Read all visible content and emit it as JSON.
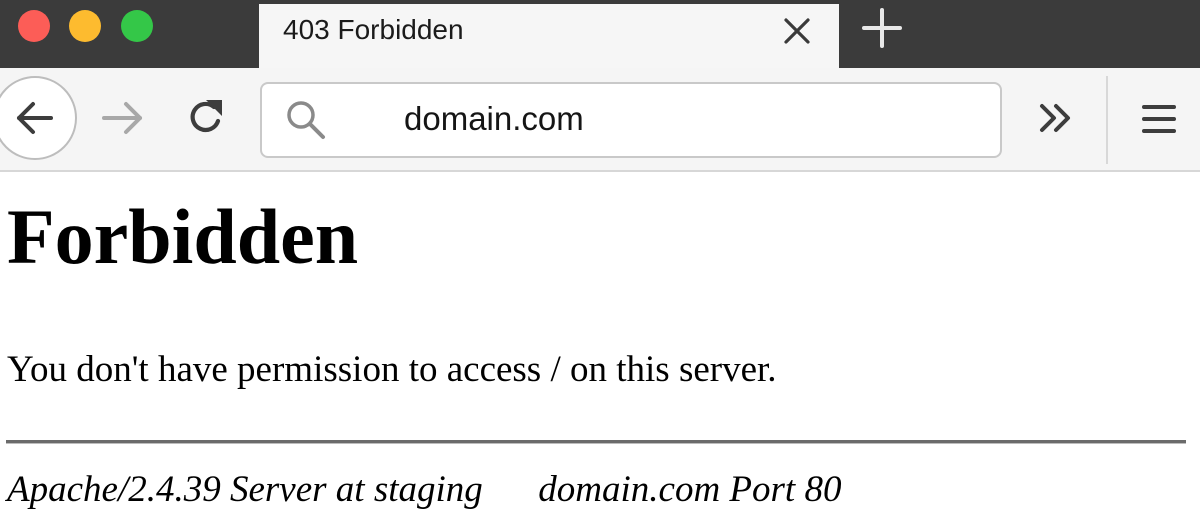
{
  "window": {
    "traffic_colors": {
      "close": "#fc5d57",
      "minimize": "#fdbb2f",
      "zoom": "#34c748"
    }
  },
  "tabs": [
    {
      "title": "403 Forbidden",
      "active": true
    }
  ],
  "tabbar": {
    "close_tab_icon": "close-icon",
    "new_tab_icon": "plus-icon"
  },
  "toolbar": {
    "back_icon": "arrow-left-icon",
    "forward_icon": "arrow-right-icon",
    "reload_icon": "reload-icon",
    "overflow_icon": "double-chevron-right-icon",
    "menu_icon": "hamburger-icon"
  },
  "urlbar": {
    "search_icon": "search-icon",
    "value": "domain.com"
  },
  "content": {
    "title": "Forbidden",
    "message": "You don't have permission to access / on this server.",
    "footer": "Apache/2.4.39 Server at staging      domain.com Port 80"
  }
}
